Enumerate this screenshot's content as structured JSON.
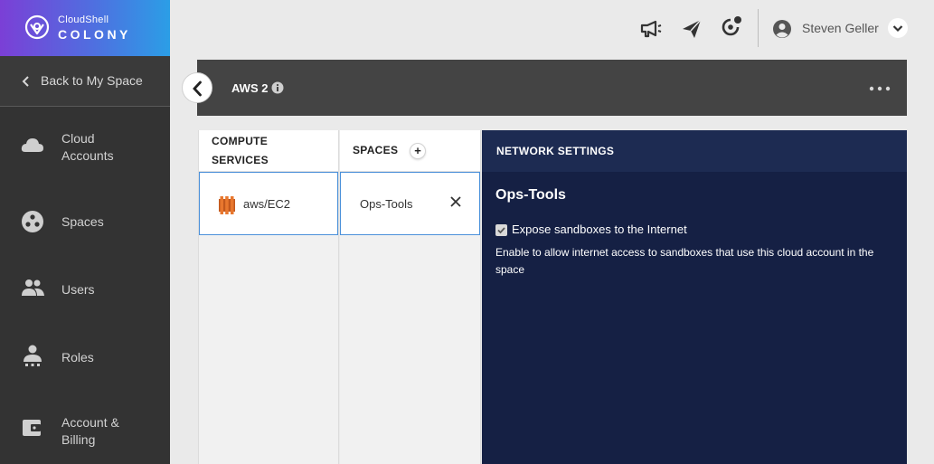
{
  "brand": {
    "sub": "CloudShell",
    "main": "COLONY"
  },
  "sidebar": {
    "back_label": "Back to My Space",
    "items": [
      {
        "label": "Cloud Accounts",
        "icon": "cloud-icon"
      },
      {
        "label": "Spaces",
        "icon": "spaces-icon"
      },
      {
        "label": "Users",
        "icon": "users-icon"
      },
      {
        "label": "Roles",
        "icon": "roles-icon"
      },
      {
        "label": "Account & Billing",
        "icon": "wallet-icon"
      }
    ]
  },
  "topbar": {
    "icons": [
      "megaphone-icon",
      "send-icon",
      "notifications-icon"
    ],
    "user_name": "Steven Geller"
  },
  "header": {
    "title": "AWS 2"
  },
  "columns": {
    "compute": {
      "heading": "COMPUTE SERVICES",
      "item": "aws/EC2"
    },
    "spaces": {
      "heading": "SPACES",
      "item": "Ops-Tools"
    }
  },
  "network": {
    "heading": "NETWORK SETTINGS",
    "title": "Ops-Tools",
    "checkbox_label": "Expose sandboxes to the Internet",
    "checkbox_checked": true,
    "description": "Enable to allow internet access to sandboxes that use this cloud account in the space"
  },
  "colors": {
    "sidebar_bg": "#333333",
    "header_bg": "#444444",
    "panel_bg": "#152044",
    "accent_border": "#4a90d9",
    "aws_orange": "#e8772e"
  }
}
